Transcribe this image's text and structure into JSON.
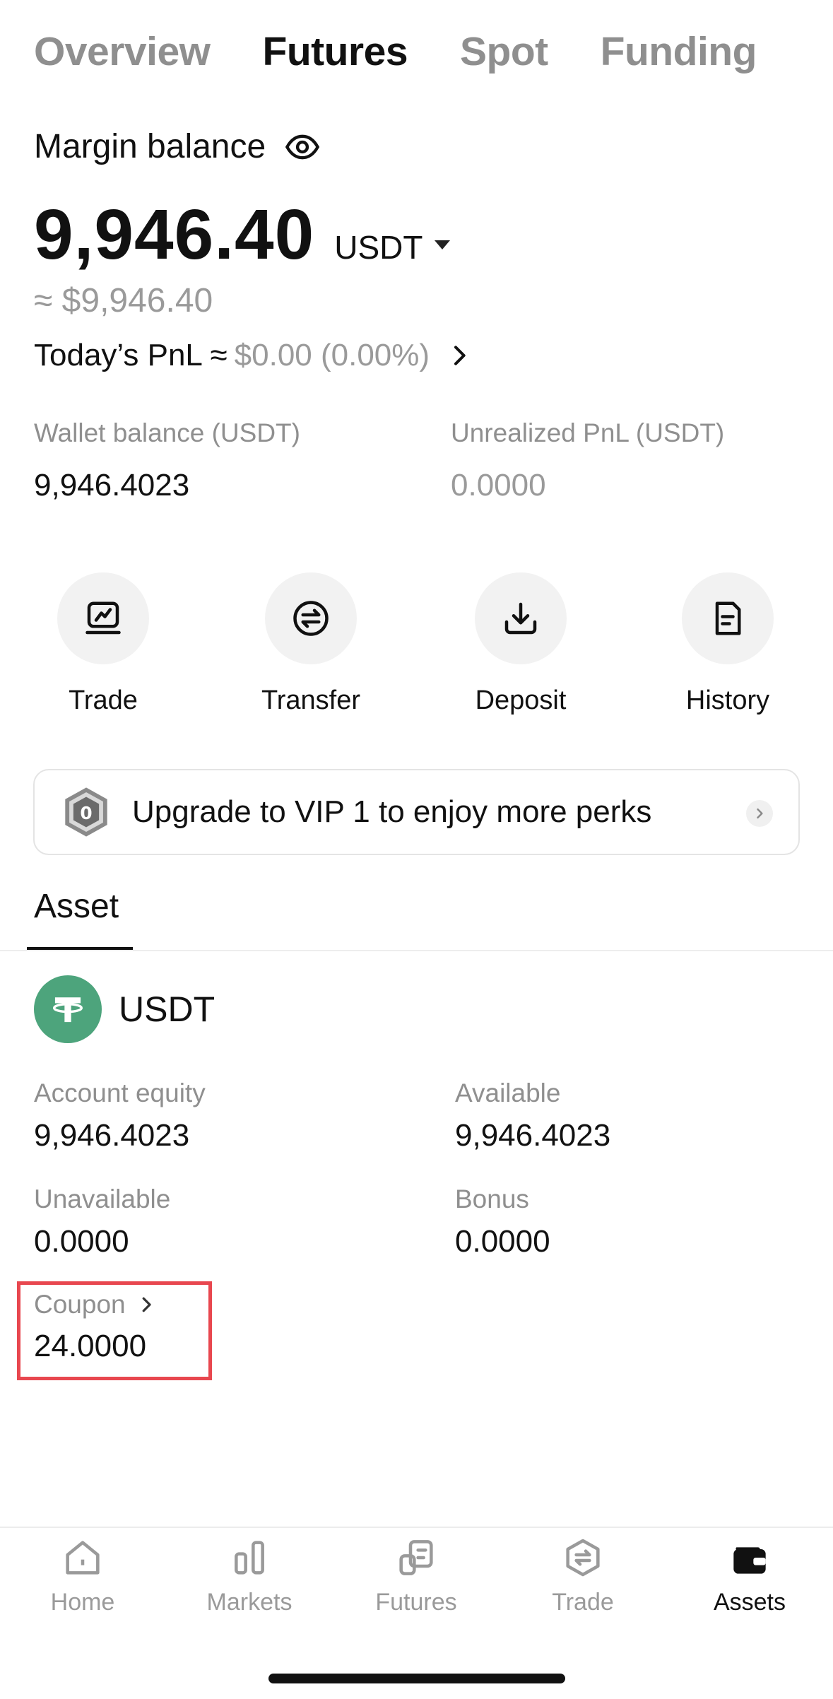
{
  "tabs": [
    {
      "label": "Overview",
      "active": false
    },
    {
      "label": "Futures",
      "active": true
    },
    {
      "label": "Spot",
      "active": false
    },
    {
      "label": "Funding",
      "active": false
    }
  ],
  "margin": {
    "label": "Margin balance",
    "balance": "9,946.40",
    "currency": "USDT",
    "approx": "≈ $9,946.40",
    "pnl_label": "Today’s PnL ≈",
    "pnl_value": "$0.00 (0.00%)"
  },
  "stats": {
    "wallet_label": "Wallet balance (USDT)",
    "wallet_value": "9,946.4023",
    "unrealized_label": "Unrealized PnL (USDT)",
    "unrealized_value": "0.0000"
  },
  "actions": [
    {
      "label": "Trade",
      "icon": "trade-icon"
    },
    {
      "label": "Transfer",
      "icon": "transfer-icon"
    },
    {
      "label": "Deposit",
      "icon": "deposit-icon"
    },
    {
      "label": "History",
      "icon": "history-icon"
    }
  ],
  "vip": {
    "badge": "0",
    "text_pre": "Upgrade to",
    "level": "VIP 1",
    "text_post": "to enjoy more perks"
  },
  "asset": {
    "tab_label": "Asset",
    "coin": "USDT",
    "equity_label": "Account equity",
    "equity_value": "9,946.4023",
    "available_label": "Available",
    "available_value": "9,946.4023",
    "unavailable_label": "Unavailable",
    "unavailable_value": "0.0000",
    "bonus_label": "Bonus",
    "bonus_value": "0.0000",
    "coupon_label": "Coupon",
    "coupon_value": "24.0000"
  },
  "nav": [
    {
      "label": "Home",
      "icon": "home-icon",
      "active": false
    },
    {
      "label": "Markets",
      "icon": "markets-icon",
      "active": false
    },
    {
      "label": "Futures",
      "icon": "futures-icon",
      "active": false
    },
    {
      "label": "Trade",
      "icon": "trade-nav-icon",
      "active": false
    },
    {
      "label": "Assets",
      "icon": "wallet-icon",
      "active": true
    }
  ],
  "colors": {
    "highlight": "#e8474f",
    "tether": "#4da47c",
    "muted": "#9a9a9a"
  }
}
